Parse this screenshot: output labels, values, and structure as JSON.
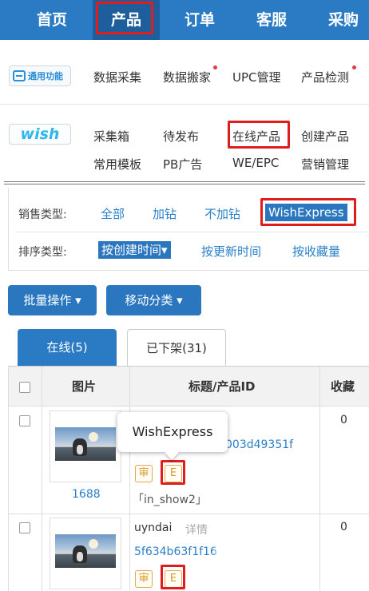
{
  "top_nav": {
    "items": [
      {
        "label": "首页"
      },
      {
        "label": "产品"
      },
      {
        "label": "订单"
      },
      {
        "label": "客服"
      },
      {
        "label": "采购"
      }
    ],
    "active": "产品"
  },
  "general": {
    "logo_text": "通用功能",
    "links": [
      {
        "label": "数据采集"
      },
      {
        "label": "数据搬家"
      },
      {
        "label": "UPC管理"
      },
      {
        "label": "产品检测"
      }
    ]
  },
  "wish": {
    "logo_text": "wish",
    "links": [
      {
        "label": "采集箱"
      },
      {
        "label": "待发布"
      },
      {
        "label": "在线产品"
      },
      {
        "label": "创建产品"
      },
      {
        "label": "常用模板"
      },
      {
        "label": "PB广告"
      },
      {
        "label": "WE/EPC"
      },
      {
        "label": "营销管理"
      }
    ]
  },
  "filters": {
    "sales_type_label": "销售类型:",
    "sales_type_options": [
      "全部",
      "加钻",
      "不加钻",
      "WishExpress"
    ],
    "sales_type_selected": "WishExpress",
    "sort_type_label": "排序类型:",
    "sort_selected": "按创建时间",
    "sort_options": [
      "按更新时间",
      "按收藏量"
    ]
  },
  "actions": {
    "batch_label": "批量操作 ▾",
    "move_label": "移动分类 ▾"
  },
  "tabs": [
    {
      "label": "在线(5)"
    },
    {
      "label": "已下架(31)"
    }
  ],
  "table": {
    "headers": {
      "image": "图片",
      "title": "标题/产品ID",
      "favorites": "收藏"
    },
    "rows": [
      {
        "image_caption": "1688",
        "product_id_partial": "003d49351f",
        "badge_audit": "审",
        "badge_express": "E",
        "tag": "「in_show2」",
        "favorites": "0"
      },
      {
        "title": "uyndai",
        "detail_link": "详情",
        "product_id": "5f634b63f1f16",
        "badge_audit": "审",
        "badge_express": "E",
        "favorites": "0"
      }
    ]
  },
  "tooltip": {
    "text": "WishExpress"
  }
}
